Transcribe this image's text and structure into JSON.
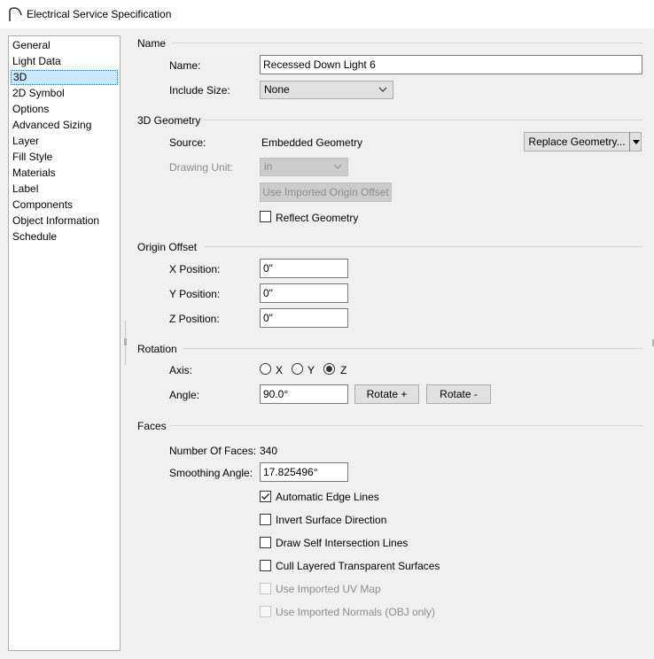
{
  "window": {
    "title": "Electrical Service Specification"
  },
  "sidebar": {
    "items": [
      {
        "label": "General"
      },
      {
        "label": "Light Data"
      },
      {
        "label": "3D",
        "selected": true
      },
      {
        "label": "2D Symbol"
      },
      {
        "label": "Options"
      },
      {
        "label": "Advanced Sizing"
      },
      {
        "label": "Layer"
      },
      {
        "label": "Fill Style"
      },
      {
        "label": "Materials"
      },
      {
        "label": "Label"
      },
      {
        "label": "Components"
      },
      {
        "label": "Object Information"
      },
      {
        "label": "Schedule"
      }
    ]
  },
  "name_section": {
    "title": "Name",
    "name_label": "Name:",
    "name_value": "Recessed Down Light 6",
    "include_size_label": "Include Size:",
    "include_size_value": "None"
  },
  "geometry_section": {
    "title": "3D Geometry",
    "source_label": "Source:",
    "source_value": "Embedded Geometry",
    "replace_button": "Replace Geometry...",
    "drawing_unit_label": "Drawing Unit:",
    "drawing_unit_value": "in",
    "use_origin_button": "Use Imported Origin Offset",
    "reflect_label": "Reflect Geometry",
    "reflect_checked": false
  },
  "origin_section": {
    "title": "Origin Offset",
    "x_label": "X Position:",
    "x_value": "0\"",
    "y_label": "Y Position:",
    "y_value": "0\"",
    "z_label": "Z Position:",
    "z_value": "0\""
  },
  "rotation_section": {
    "title": "Rotation",
    "axis_label": "Axis:",
    "axis_x": "X",
    "axis_y": "Y",
    "axis_z": "Z",
    "axis_selected": "Z",
    "angle_label": "Angle:",
    "angle_value": "90.0°",
    "rotate_plus": "Rotate +",
    "rotate_minus": "Rotate -"
  },
  "faces_section": {
    "title": "Faces",
    "num_faces_label": "Number Of Faces:",
    "num_faces_value": "340",
    "smoothing_label": "Smoothing Angle:",
    "smoothing_value": "17.825496°",
    "options": [
      {
        "label": "Automatic Edge Lines",
        "checked": true,
        "enabled": true
      },
      {
        "label": "Invert Surface Direction",
        "checked": false,
        "enabled": true
      },
      {
        "label": "Draw Self Intersection Lines",
        "checked": false,
        "enabled": true
      },
      {
        "label": "Cull Layered Transparent Surfaces",
        "checked": false,
        "enabled": true
      },
      {
        "label": "Use Imported UV Map",
        "checked": false,
        "enabled": false
      },
      {
        "label": "Use Imported Normals (OBJ only)",
        "checked": false,
        "enabled": false
      }
    ]
  },
  "colors": {
    "selection": "#cce8ff",
    "disabled_text": "#8d8d8d"
  }
}
